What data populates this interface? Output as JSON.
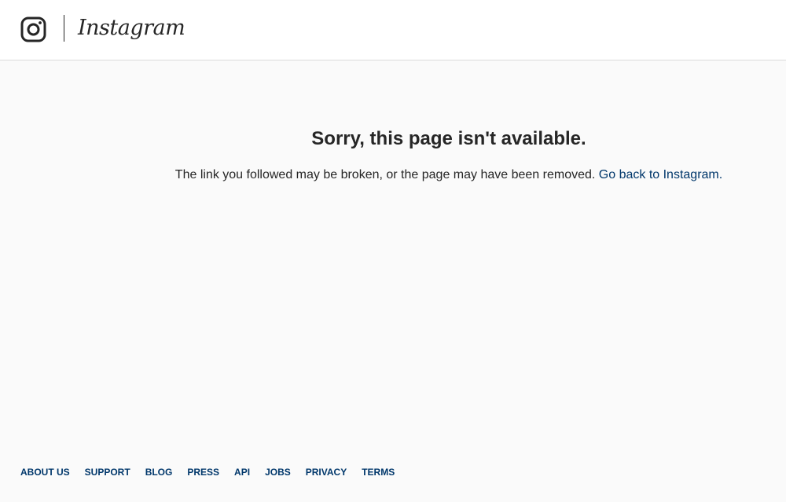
{
  "header": {
    "logo_icon": "instagram-camera-icon",
    "wordmark": "Instagram"
  },
  "main": {
    "title": "Sorry, this page isn't available.",
    "message": "The link you followed may be broken, or the page may have been removed.",
    "back_link": "Go back to Instagram."
  },
  "footer": {
    "links": [
      "ABOUT US",
      "SUPPORT",
      "BLOG",
      "PRESS",
      "API",
      "JOBS",
      "PRIVACY",
      "TERMS"
    ]
  },
  "colors": {
    "background": "#fafafa",
    "header_background": "#ffffff",
    "text": "#262626",
    "link": "#00376b",
    "border": "#dbdbdb"
  }
}
